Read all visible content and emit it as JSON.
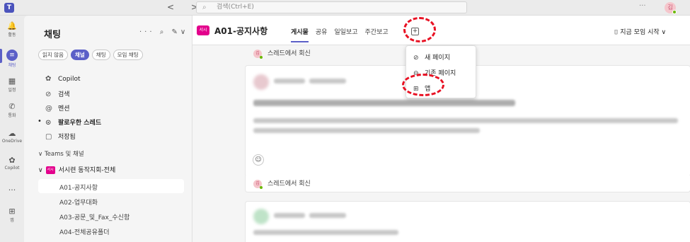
{
  "titlebar": {
    "logo": "T",
    "nav": "< >",
    "search_placeholder": "검색(Ctrl+E)",
    "more": "···",
    "avatar": "김"
  },
  "rail": [
    {
      "name": "activity",
      "icon": "🔔",
      "label": "활동"
    },
    {
      "name": "chat",
      "icon": "≡",
      "label": "채팅",
      "active": true
    },
    {
      "name": "calendar",
      "icon": "▦",
      "label": "일정"
    },
    {
      "name": "calls",
      "icon": "✆",
      "label": "통화"
    },
    {
      "name": "onedrive",
      "icon": "☁",
      "label": "OneDrive"
    },
    {
      "name": "copilot",
      "icon": "✿",
      "label": "Copilot"
    },
    {
      "name": "more",
      "icon": "···",
      "label": ""
    },
    {
      "name": "apps",
      "icon": "⊞",
      "label": "앱"
    }
  ],
  "sidebar": {
    "title": "채팅",
    "actions": "··· ⌕ ✎∨",
    "chips": [
      {
        "label": "읽지 않음",
        "selected": false
      },
      {
        "label": "채널",
        "selected": true
      },
      {
        "label": "채팅",
        "selected": false
      },
      {
        "label": "모임 채팅",
        "selected": false
      }
    ],
    "items": [
      {
        "icon": "✿",
        "label": "Copilot"
      },
      {
        "icon": "⊘",
        "label": "검색"
      },
      {
        "icon": "@",
        "label": "멘션"
      },
      {
        "icon": "⊙",
        "label": "팔로우한 스레드"
      },
      {
        "icon": "▢",
        "label": "저장됨"
      }
    ],
    "section": "Teams 및 채널",
    "team": {
      "badge": "서시",
      "name": "서시련 동작지회-전체"
    },
    "channels": [
      "A01-공지사항",
      "A02-업무대화",
      "A03-공문_및_Fax_수신함",
      "A04-전체공유폴더"
    ]
  },
  "header": {
    "badge": "서시",
    "title": "A01-공지사항",
    "tabs": [
      "게시물",
      "공유",
      "일일보고",
      "주간보고"
    ],
    "meet": "⌷ 지금 모임 시작 ∨"
  },
  "thread": {
    "reply_label": "스레드에서 회신",
    "emoji": "☺"
  },
  "menu": {
    "items": [
      {
        "icon": "⊘",
        "label": "새 페이지"
      },
      {
        "icon": "⊖",
        "label": "기존 페이지"
      },
      {
        "icon": "⊞",
        "label": "앱"
      }
    ]
  },
  "colors": {
    "accent": "#5b5fc7",
    "team_badge": "#e3008c",
    "annotation": "#e81123"
  }
}
